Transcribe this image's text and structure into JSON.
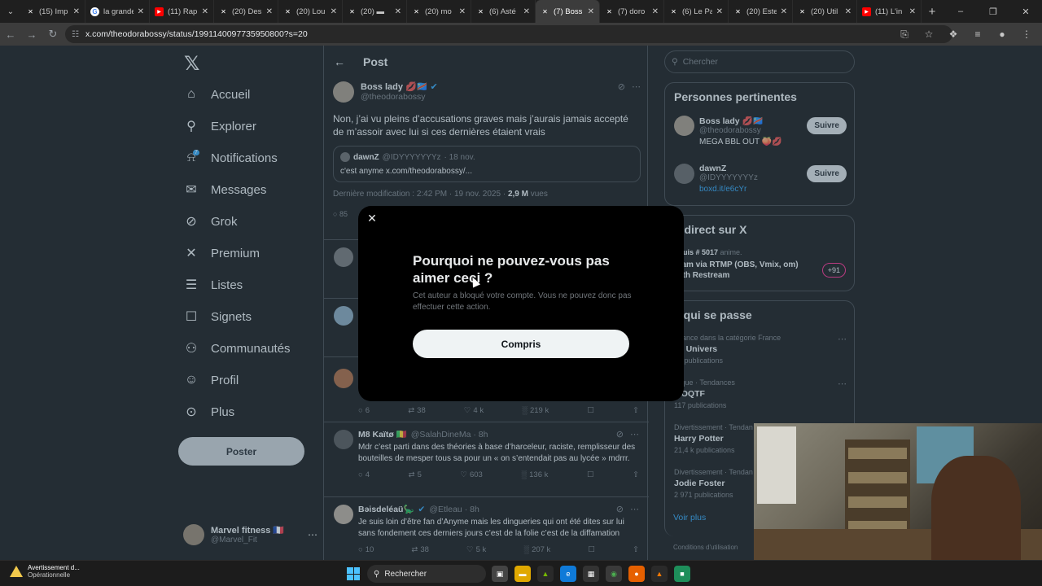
{
  "browser": {
    "tabs": [
      {
        "title": "(15) Imp",
        "fav": "x"
      },
      {
        "title": "la grande",
        "fav": "g"
      },
      {
        "title": "(11) Rap",
        "fav": "yt"
      },
      {
        "title": "(20) Des",
        "fav": "x"
      },
      {
        "title": "(20) Lou",
        "fav": "x"
      },
      {
        "title": "(20) ▬",
        "fav": "x"
      },
      {
        "title": "(20) mo",
        "fav": "x"
      },
      {
        "title": "(6) Asté",
        "fav": "x"
      },
      {
        "title": "(7) Boss",
        "fav": "x",
        "active": true
      },
      {
        "title": "(7) doro",
        "fav": "x"
      },
      {
        "title": "(6) Le Pa",
        "fav": "x"
      },
      {
        "title": "(20) Este",
        "fav": "x"
      },
      {
        "title": "(20) Util",
        "fav": "x"
      },
      {
        "title": "(11) L'in",
        "fav": "yt"
      }
    ],
    "url": "x.com/theodorabossy/status/1991140097735950800?s=20"
  },
  "nav": {
    "items": [
      "Accueil",
      "Explorer",
      "Notifications",
      "Messages",
      "Grok",
      "Premium",
      "Listes",
      "Signets",
      "Communautés",
      "Profil",
      "Plus"
    ],
    "notif_badge": "7",
    "post_button": "Poster",
    "account_name": "Marvel fitness 🇫🇷",
    "account_handle": "@Marvel_Fit"
  },
  "post": {
    "header": "Post",
    "author_name": "Boss lady 💋🇨🇩",
    "author_handle": "@theodorabossy",
    "text": "Non, j’ai vu pleins d’accusations graves mais j’aurais jamais accepté de m’assoir avec lui si ces dernières étaient vrais",
    "quote_name": "dawnZ",
    "quote_handle": "@IDYYYYYYYz",
    "quote_date": "· 18 nov.",
    "quote_text": "c'est anyme x.com/theodorabossy/...",
    "meta_left": "Dernière modification : 2:42 PM · 19 nov. 2025 ·",
    "meta_views": "2,9 M",
    "meta_views_label": "vues",
    "partial_count": "85"
  },
  "replies": [
    {
      "name": "",
      "handle": "",
      "text": "",
      "stats": [
        "6",
        "38",
        "4 k",
        "219 k"
      ]
    },
    {
      "name": "M8 Kaïtø 🇲🇱",
      "handle": "@SalahDineMa · 8h",
      "text": "Mdr c’est parti dans des théories à base d’harceleur, raciste, remplisseur des bouteilles de mesper tous sa pour un « on s’entendait pas au lycée » mdrrr.",
      "stats": [
        "4",
        "5",
        "603",
        "136 k"
      ]
    },
    {
      "name": "Bəisdeléaü🦕",
      "handle": "@Etleau · 8h",
      "text": "Je suis loin d’être fan d’Anyme mais les dingueries qui ont été dites sur lui sans fondement ces derniers jours c’est de la folie c’est de la diffamation",
      "stats": [
        "10",
        "38",
        "5 k",
        "207 k"
      ]
    }
  ],
  "sidebar": {
    "search_placeholder": "Chercher",
    "relevant_title": "Personnes pertinentes",
    "people": [
      {
        "name": "Boss lady 💋🇨🇩",
        "handle": "@theodorabossy",
        "bio": "MEGA BBL OUT 🍑💋",
        "follow": "Suivre"
      },
      {
        "name": "dawnZ",
        "handle": "@IDYYYYYYYz",
        "bio": "boxd.it/e6cYr",
        "follow": "Suivre"
      }
    ],
    "live_title": "n direct sur X",
    "live_user": "Louis # 5017",
    "live_status": "anime.",
    "live_text": "ream via RTMP (OBS, Vmix, om) with Restream",
    "live_count": "+91",
    "happening_title": "e qui se passe",
    "trends": [
      {
        "cat": "ndance dans la catégorie France",
        "name": "ss Univers",
        "count": "79 publications"
      },
      {
        "cat": "litique · Tendances",
        "name": "s OQTF",
        "count": "117 publications"
      },
      {
        "cat": "Divertissement · Tendan",
        "name": "Harry Potter",
        "count": "21,4 k publications"
      },
      {
        "cat": "Divertissement · Tendan",
        "name": "Jodie Foster",
        "count": "2 971 publications"
      }
    ],
    "show_more": "Voir plus",
    "footer": "Conditions d'utilisation"
  },
  "modal": {
    "title": "Pourquoi ne pouvez-vous pas aimer ceci ?",
    "text": "Cet auteur a bloqué votre compte. Vous ne pouvez donc pas effectuer cette action.",
    "button": "Compris"
  },
  "taskbar": {
    "warning_title": "Avertissement d...",
    "warning_sub": "Opérationnelle",
    "search": "Rechercher"
  }
}
